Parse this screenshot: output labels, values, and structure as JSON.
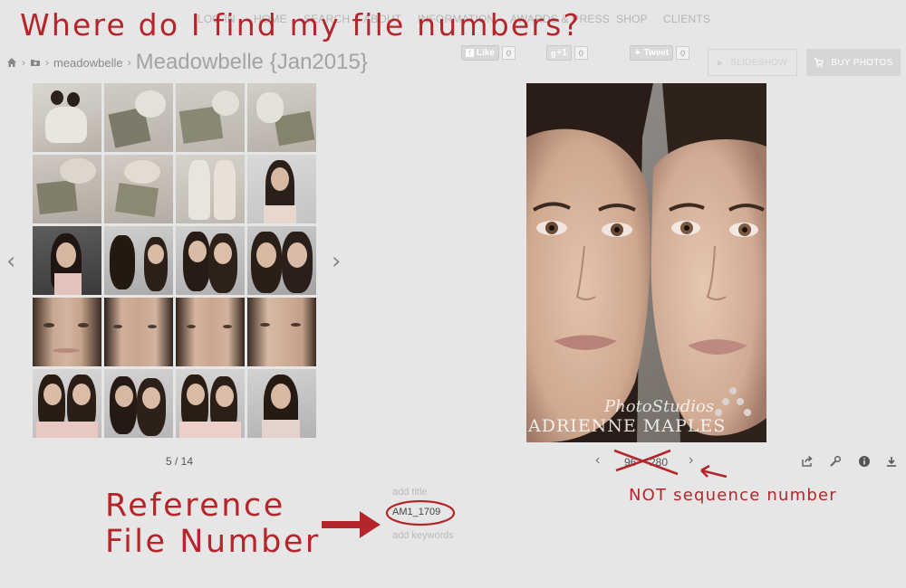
{
  "annotations": {
    "headline": "Where do I find my file numbers?",
    "reference_line1": "Reference",
    "reference_line2": "File Number",
    "not_sequence": "NOT sequence number"
  },
  "nav": {
    "items": [
      "LOG IN",
      "HOME",
      "SEARCH",
      "ABOUT",
      "INFORMATION",
      "AWARDS & PRESS",
      "SHOP",
      "CLIENTS"
    ]
  },
  "breadcrumb": {
    "link": "meadowbelle",
    "title": "Meadowbelle {Jan2015}"
  },
  "social": {
    "like_label": "Like",
    "like_count": "0",
    "gplus_label": "+1",
    "gplus_count": "0",
    "tweet_label": "Tweet",
    "tweet_count": "0"
  },
  "buttons": {
    "slideshow": "SLIDESHOW",
    "buy_photos": "BUY PHOTOS"
  },
  "gallery": {
    "page_indicator": "5 / 14"
  },
  "photo": {
    "watermark_line1": "PhotoStudios",
    "watermark_line2": "ADRIENNE MAPLES",
    "sequence_current": "96",
    "sequence_total": "280"
  },
  "metadata": {
    "add_title": "add title",
    "file_number": "AM1_1709",
    "add_keywords": "add keywords"
  },
  "colors": {
    "annotation_red": "#b4262a",
    "background": "#e6e6e6"
  }
}
